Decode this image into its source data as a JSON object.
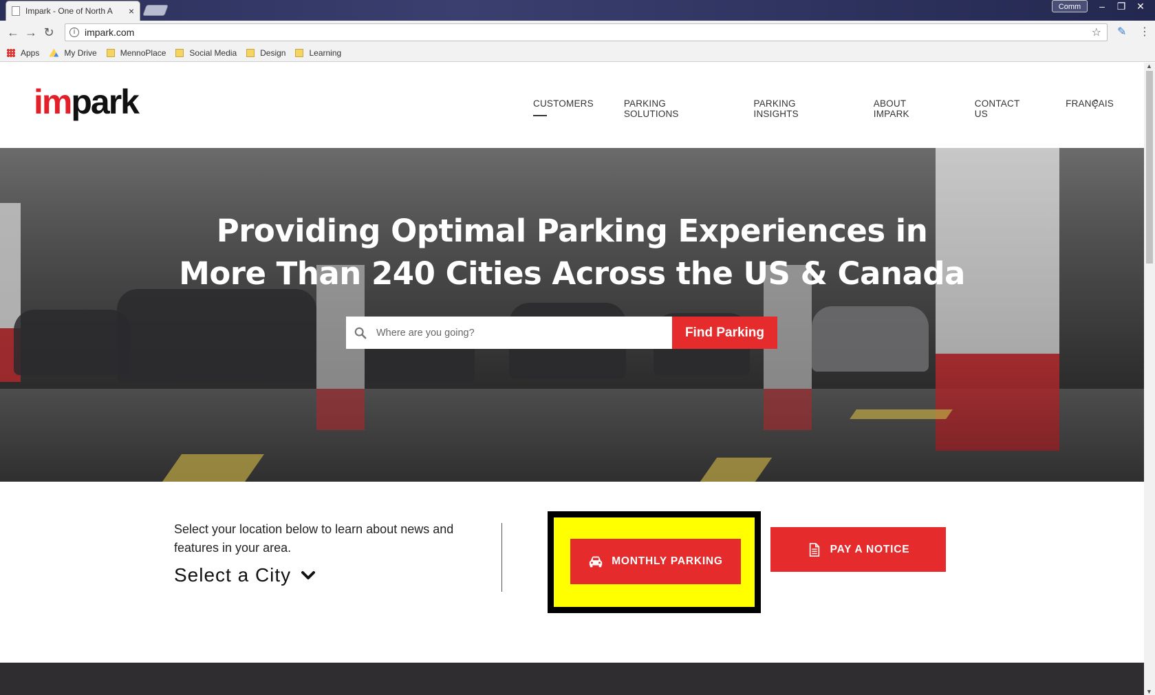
{
  "browser": {
    "tab_title": "Impark - One of North A",
    "tab_close": "×",
    "user_label": "Comm",
    "win_minimize": "–",
    "win_restore": "❐",
    "win_close": "✕",
    "url": "impark.com",
    "bookmarks": [
      "Apps",
      "My Drive",
      "MennoPlace",
      "Social Media",
      "Design",
      "Learning"
    ]
  },
  "site": {
    "logo_im": "im",
    "logo_park": "park",
    "nav": [
      "CUSTOMERS",
      "PARKING SOLUTIONS",
      "PARKING INSIGHTS",
      "ABOUT IMPARK",
      "CONTACT US",
      "FRANÇAIS"
    ],
    "active_nav": "CUSTOMERS",
    "hero": {
      "title_line1": "Providing Optimal Parking Experiences in",
      "title_line2": "More Than 240 Cities Across the US & Canada",
      "search_placeholder": "Where are you going?",
      "find_button": "Find Parking"
    },
    "features": {
      "location_text": "Select your location below to learn about news and features in your area.",
      "city_select": "Select a City",
      "monthly_button": "MONTHLY PARKING",
      "notice_button": "PAY A NOTICE"
    }
  },
  "colors": {
    "brand_red": "#e52b2b",
    "highlight_yellow": "#ffff00"
  },
  "icons": [
    "search-icon",
    "car-icon",
    "document-icon",
    "chevron-down-icon",
    "star-icon"
  ]
}
